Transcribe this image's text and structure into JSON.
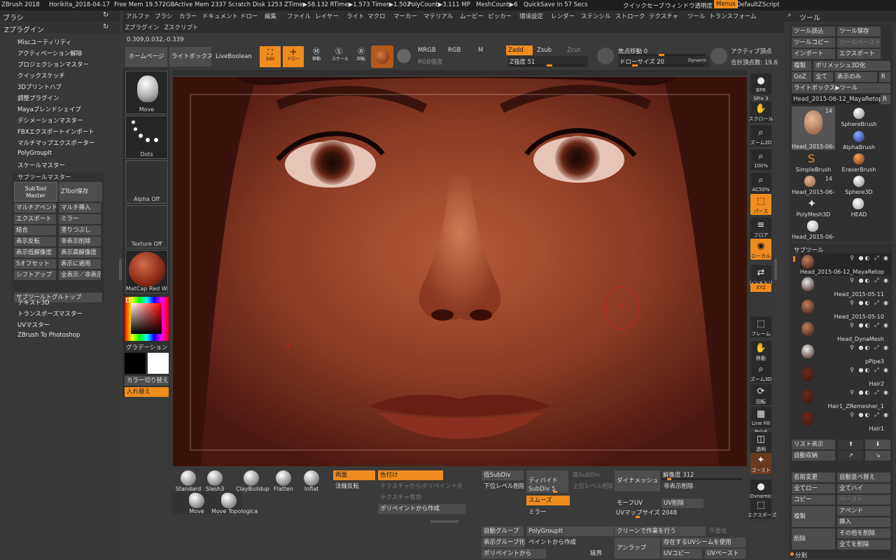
{
  "titlebar": {
    "app": "ZBrush 2018",
    "file": "Horikita_2018-04-17",
    "free_mem": "Free Mem 19.572GB",
    "active_mem": "Active Mem 2337",
    "scratch": "Scratch Disk 1253",
    "ztime": "ZTime▶58.132 RTime▶1.573 Timer▶1.502",
    "polycount": "PolyCount▶3.111 MP",
    "meshcount": "MeshCount▶6",
    "quicksave": "QuickSave In 57 Secs",
    "quicksave_btn": "クイックセーブ",
    "window_trans": "ウィンドウ透明度",
    "menus": "Menus",
    "default_zscript": "DefaultZScript"
  },
  "menubar": [
    "アルファ",
    "ブラシ",
    "カラー",
    "ドキュメント",
    "ドロー",
    "編集",
    "ファイル",
    "レイヤー",
    "ライト",
    "マクロ",
    "マーカー",
    "マテリアル",
    "ムービー",
    "ピッカー",
    "環境設定",
    "レンダー",
    "ステンシル",
    "ストローク",
    "テクスチャ",
    "ツール",
    "トランスフォーム"
  ],
  "menubar2": [
    "Zプラグイン",
    "Zスクリプト"
  ],
  "coords": "0.309,0.032,-0.339",
  "left": {
    "brush_header": "ブラシ",
    "zplugin_header": "Zプラグイン",
    "items": [
      "Miscユーティリティ",
      "アクティベーション解除",
      "プロジェクションマスター",
      "クイックスケッチ",
      "3Dプリントハブ",
      "調整プラグイン",
      "Mayaブレンドシェイプ",
      "デシメーションマスター",
      "FBXエクスポートインポート",
      "マルチマップエクスポーター",
      "PolyGroupIt",
      "スケールマスター"
    ],
    "subtool_master_header": "サブツールマスター",
    "subtool_master_btn": "SubTool Master",
    "ztool_save": "ZTool保存",
    "grid": [
      [
        "マルチアペンド",
        "マルチ挿入"
      ],
      [
        "エクスポート",
        "ミラー"
      ],
      [
        "結合",
        "塗りつぶし"
      ],
      [
        "表示反転",
        "非表示削除"
      ],
      [
        "表示低解像度",
        "表示高解像度"
      ],
      [
        "Sオフセット",
        "表示に適用"
      ],
      [
        "シフトアップ",
        "全表示／非表示"
      ]
    ],
    "toggle_all": "サブツールトグルトップ",
    "items2": [
      "テキスト3D",
      "トランスポーズマスター",
      "UVマスター",
      "ZBrush To Photoshop"
    ]
  },
  "top": {
    "homepage": "ホームページ",
    "lightbox": "ライトボックス",
    "liveboolean": "LiveBoolean",
    "edit": "Edit",
    "draw": "ドロー",
    "move": "移動",
    "scale": "スケール",
    "rotate": "回転",
    "mrgb": "MRGB",
    "rgb": "RGB",
    "m": "M",
    "zadd": "Zadd",
    "zsub": "Zsub",
    "zcut": "Zcut",
    "rgb_intensity": "RGB強度",
    "z_intensity": "Z強度 51",
    "focal_shift": "焦点移動 0",
    "draw_size": "ドローサイズ 20",
    "dynamic": "Dynamic",
    "active_points": "アクティブ頂点",
    "total_points": "合計頂点数: 19.6"
  },
  "shelf": [
    {
      "label": "Move"
    },
    {
      "label": "Dots"
    },
    {
      "label": "Alpha Off"
    },
    {
      "label": "Texture Off"
    },
    {
      "label": "MatCap Red Wax"
    }
  ],
  "color": {
    "gradient_label": "グラデーション",
    "switch": "カラー切り替え",
    "swap": "入れ替え"
  },
  "rtool": {
    "bpr": "BPR",
    "spix": "SPix 3",
    "scroll": "スクロール",
    "zoom2d": "ズーム2D",
    "zoom100": "100%",
    "ac50": "AC50%",
    "perspective": "パース",
    "floor": "フロア",
    "local": "ローカル",
    "symmetry": "シンメトリ",
    "xyz": "XYZ",
    "frame": "フレーム",
    "move": "移動",
    "zoom3d": "ズーム3D",
    "rotate": "回転",
    "linefill": "Line Fill",
    "polyf": "PolyF",
    "transparent": "透明",
    "ghost": "ゴースト",
    "dynamic": "Dynamic",
    "solo": "ソロ",
    "xpose": "エクスポーズ"
  },
  "toolpanel": {
    "header": "ツール",
    "btns": [
      [
        "ツール読込",
        "ツール保存"
      ],
      [
        "ツールコピー",
        "ツールペースト"
      ],
      [
        "インポート",
        "エクスポート"
      ]
    ],
    "clone": "複製",
    "polymesh3d": "ポリメッシュ3D化",
    "goz": "GoZ",
    "all": "全て",
    "visible": "表示のみ",
    "r": "R",
    "lightbox_tool": "ライトボックス▶ツール",
    "current_tool": "Head_2015-06-12_MayaRetop",
    "thumbs": [
      {
        "label": "Head_2015-06-1",
        "count": "14"
      },
      {
        "label": "SphereBrush"
      },
      {
        "label": "AlphaBrush"
      },
      {
        "label": "SimpleBrush"
      },
      {
        "label": "EraserBrush"
      },
      {
        "label": "Head_2015-06-1",
        "count": "14"
      },
      {
        "label": "Sphere3D"
      },
      {
        "label": "PolyMesh3D"
      },
      {
        "label": "HEAD"
      },
      {
        "label": "Head_2015-06-1"
      }
    ],
    "subtool_header": "サブツール",
    "subtools": [
      "Head_2015-06-12_MayaRetop",
      "Head_2015-05-11",
      "Head_2015-05-10",
      "Head_DynaMesh",
      "pPipe3",
      "Hair2",
      "Hair1_ZRemesher_1",
      "Hair1"
    ],
    "list_view": "リスト表示",
    "auto_collapse": "自動収納",
    "rename": "名前変更",
    "auto_reorder": "自動並べ替え",
    "all_low": "全てロー",
    "all_high": "全てハイ",
    "copy": "コピー",
    "paste": "ペースト",
    "duplicate": "複製",
    "append": "アペンド",
    "insert": "挿入",
    "delete": "削除",
    "delete_others": "その他を削除",
    "delete_all": "全てを削除",
    "split": "分割"
  },
  "bottom": {
    "brushes": [
      "Standard",
      "Slash3",
      "ClayBuildup",
      "Flatten",
      "Inflat"
    ],
    "brushes2": [
      "Move",
      "Move Topologica"
    ],
    "double": "両面",
    "flip": "法線反転",
    "colorize": "色付け",
    "tex_from_poly": "テクスチャからポリペイント化",
    "tex_on": "テクスチャ有効",
    "poly_create": "ポリペイントから作成",
    "low_subdiv": "低SubDiv",
    "del_lower": "下位レベル削除",
    "divide": "ディバイド",
    "subdiv": "SubDiv 5",
    "high_subdiv": "高SubDiv",
    "del_higher": "上位レベル削除",
    "smooth": "スムーズ",
    "mirror": "ミラー",
    "dynamesh": "ダイナメッシュ",
    "resolution": "解像度 312",
    "hide_del": "非表示削除",
    "morph_uv": "モーフUV",
    "uv_del": "UV削除",
    "uv_map_size": "UVマップサイズ 2048",
    "auto_groups": "自動グループ",
    "polygroupit": "PolyGroupIt",
    "crease": "クリーンで作業を行う",
    "flat": "平面化",
    "visible_group": "表示グループ化",
    "from_paint": "ペイントから作成",
    "unwrap": "アンラップ",
    "use_uv": "存在するUVシームを使用",
    "from_polypaint": "ポリペイントから",
    "border": "境界",
    "uv_copy": "UVコピー",
    "uv_paste": "UVペースト"
  }
}
